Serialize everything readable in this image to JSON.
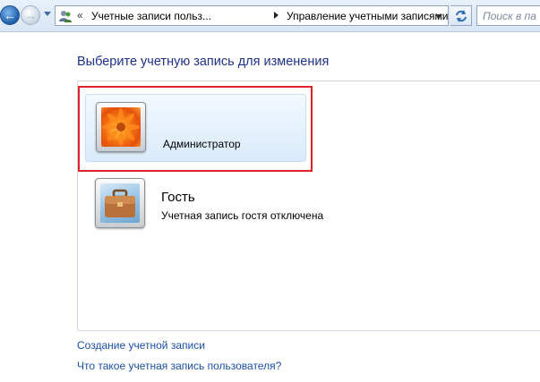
{
  "navigation": {
    "back_icon": "back-arrow-icon",
    "back_glyph": "←",
    "forward_icon": "forward-arrow-icon",
    "forward_glyph": "→",
    "history_icon": "chevron-down-icon",
    "address": {
      "folder_icon": "user-accounts-icon",
      "overflow_glyph": "«",
      "crumbs": [
        "Учетные записи польз...",
        "Управление учетными записями"
      ]
    },
    "refresh_icon": "refresh-icon",
    "search_placeholder": "Поиск в па"
  },
  "main": {
    "title": "Выберите учетную запись для изменения",
    "accounts": [
      {
        "name": "Администратор",
        "status": "",
        "picture": "orange-flower-picture",
        "selected": true,
        "highlight_color": "#e0202a"
      },
      {
        "name": "Гость",
        "status": "Учетная запись гостя отключена",
        "picture": "briefcase-picture",
        "selected": false
      }
    ],
    "links": {
      "create": "Создание учетной записи",
      "what_is": "Что такое учетная запись пользователя?"
    }
  },
  "colors": {
    "title": "#1e3287",
    "link": "#1a4fa0",
    "selection": "#e0202a",
    "tile_background": "#d9ebfb"
  }
}
